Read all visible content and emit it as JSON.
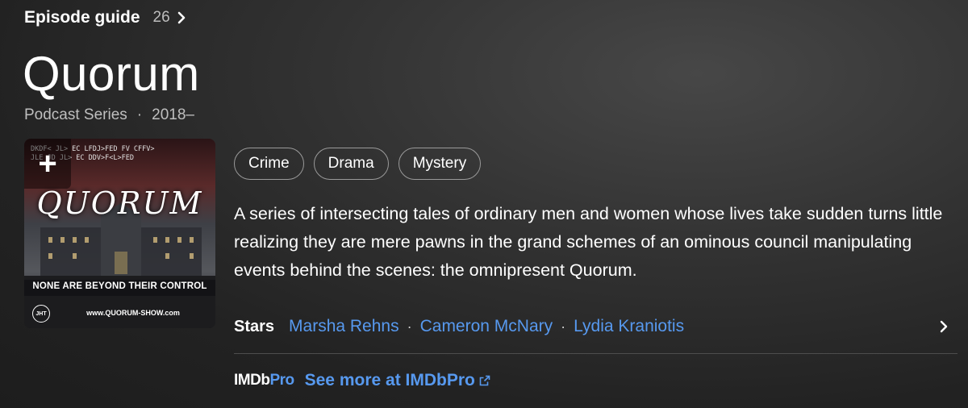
{
  "episode_guide": {
    "label": "Episode guide",
    "count": "26"
  },
  "title": "Quorum",
  "meta": {
    "type": "Podcast Series",
    "separator": "·",
    "years": "2018–"
  },
  "poster": {
    "add_symbol": "+",
    "logo_text": "QUORUM",
    "tagline": "NONE ARE BEYOND THEIR CONTROL",
    "url": "www.QUORUM-SHOW.com",
    "code_line1": "DKDF< JL> EC LFDJ>FED FV CFFV>",
    "code_line2": "JLE JD JL> EC DDV>F<L>FED",
    "badge": "JHT"
  },
  "genres": [
    "Crime",
    "Drama",
    "Mystery"
  ],
  "plot": "A series of intersecting tales of ordinary men and women whose lives take sudden turns little realizing they are mere pawns in the grand schemes of an ominous council manipulating events behind the scenes: the omnipresent Quorum.",
  "stars": {
    "label": "Stars",
    "separator": "·",
    "names": [
      "Marsha Rehns",
      "Cameron McNary",
      "Lydia Kraniotis"
    ]
  },
  "imdbpro": {
    "logo_part1": "IMDb",
    "logo_part2": "Pro",
    "link_label": "See more at IMDbPro"
  },
  "colors": {
    "link": "#5799ef",
    "background": "#2a2a2a",
    "muted": "#bfbfbf"
  }
}
